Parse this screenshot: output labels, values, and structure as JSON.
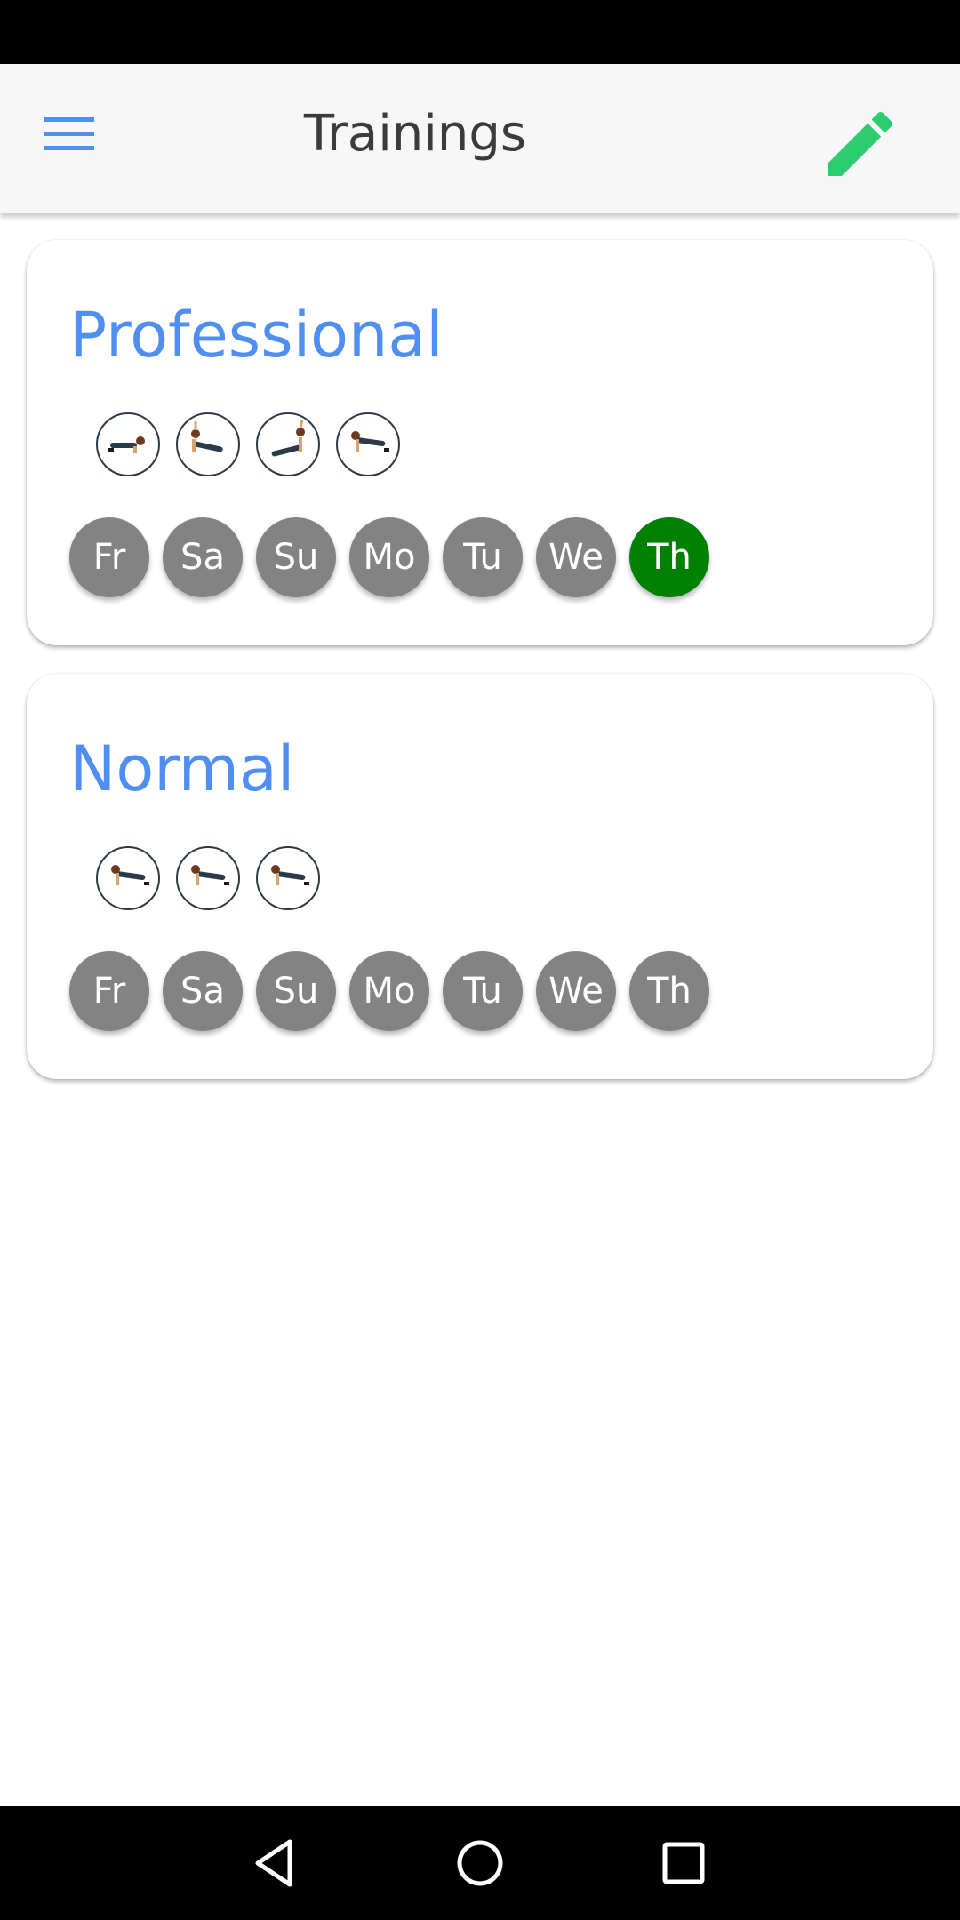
{
  "app": {
    "title": "Trainings"
  },
  "header": {
    "menu_icon": "menu-icon",
    "edit_icon": "edit-pencil-icon"
  },
  "colors": {
    "accent": "#4f8ef2",
    "edit": "#2ecc71",
    "day_inactive": "#838383",
    "day_active": "#008000"
  },
  "trainings": [
    {
      "name": "Professional",
      "exercises": [
        "plank-icon",
        "side-plank-icon",
        "side-plank-icon",
        "pushup-icon"
      ],
      "days": [
        {
          "label": "Fr",
          "active": false
        },
        {
          "label": "Sa",
          "active": false
        },
        {
          "label": "Su",
          "active": false
        },
        {
          "label": "Mo",
          "active": false
        },
        {
          "label": "Tu",
          "active": false
        },
        {
          "label": "We",
          "active": false
        },
        {
          "label": "Th",
          "active": true
        }
      ]
    },
    {
      "name": "Normal",
      "exercises": [
        "pushup-icon",
        "pushup-icon",
        "pushup-icon"
      ],
      "days": [
        {
          "label": "Fr",
          "active": false
        },
        {
          "label": "Sa",
          "active": false
        },
        {
          "label": "Su",
          "active": false
        },
        {
          "label": "Mo",
          "active": false
        },
        {
          "label": "Tu",
          "active": false
        },
        {
          "label": "We",
          "active": false
        },
        {
          "label": "Th",
          "active": false
        }
      ]
    }
  ],
  "navigation": {
    "back": "back-icon",
    "home": "home-icon",
    "recents": "recents-icon"
  }
}
